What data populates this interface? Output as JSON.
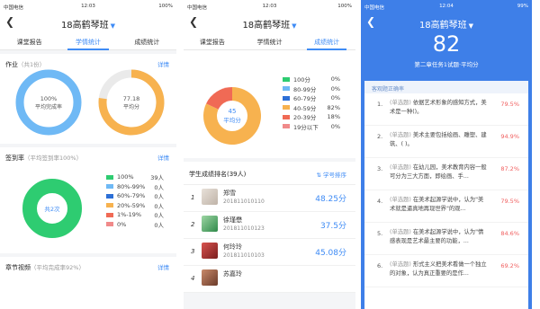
{
  "status": {
    "carrier": "中国电信",
    "p1": {
      "time": "12:03",
      "battery": "100%"
    },
    "p2": {
      "time": "12:03",
      "battery": "100%"
    },
    "p3": {
      "time": "12:04",
      "battery": "99%"
    }
  },
  "header_title": "18高鹤琴班",
  "tabs": [
    "课堂报告",
    "学情统计",
    "成绩统计"
  ],
  "colors": {
    "accent": "#3e8bf5",
    "green": "#2ecc71",
    "blue_light": "#6fb9f5",
    "orange": "#f7b24f",
    "red": "#f06a55",
    "gray": "#e0e0e0"
  },
  "p1": {
    "homework": {
      "title": "作业",
      "sub": "（共1份）",
      "detail": "详情",
      "left_ring": {
        "value": "100%",
        "label": "平均完成率",
        "fraction": 1.0
      },
      "right_ring": {
        "value": "77.18",
        "label": "平均分",
        "fraction": 0.7718
      }
    },
    "signin": {
      "title": "签到率",
      "sub": "（平均签到率100%）",
      "detail": "详情",
      "center": "共2次",
      "legend": [
        {
          "label": "100%",
          "count": "39人",
          "color": "#2ecc71"
        },
        {
          "label": "80%-99%",
          "count": "0人",
          "color": "#6fb9f5"
        },
        {
          "label": "60%-79%",
          "count": "0人",
          "color": "#2c6fd6"
        },
        {
          "label": "20%-59%",
          "count": "0人",
          "color": "#f7b24f"
        },
        {
          "label": "1%-19%",
          "count": "0人",
          "color": "#f06a55"
        },
        {
          "label": "0%",
          "count": "0人",
          "color": "#f08a8a"
        }
      ]
    },
    "video": {
      "title": "章节视频",
      "sub": "（平均完成率92%）",
      "detail": "详情"
    }
  },
  "p2": {
    "donut_center_value": "45",
    "donut_center_label": "平均分",
    "ranking_title": "学生成绩排名(39人)",
    "sort_label": "学号排序",
    "rows": [
      {
        "rank": "1",
        "name": "郑雪",
        "id": "201811010110",
        "score": "48.25分"
      },
      {
        "rank": "2",
        "name": "徐瑾懋",
        "id": "201811010123",
        "score": "37.5分"
      },
      {
        "rank": "3",
        "name": "何玲玲",
        "id": "201811010103",
        "score": "45.08分"
      },
      {
        "rank": "4",
        "name": "苏嘉玲",
        "id": "",
        "score": ""
      }
    ]
  },
  "chart_data": {
    "type": "pie",
    "categories": [
      "100分",
      "80-99分",
      "60-79分",
      "40-59分",
      "20-39分",
      "19分以下"
    ],
    "values": [
      0,
      0,
      0,
      82,
      18,
      0
    ],
    "value_labels": [
      "0%",
      "0%",
      "0%",
      "82%",
      "18%",
      "0%"
    ],
    "colors": [
      "#2ecc71",
      "#6fb9f5",
      "#2c6fd6",
      "#f7b24f",
      "#f06a55",
      "#f08a8a"
    ]
  },
  "p3": {
    "big_score": "82",
    "subtitle": "第二章任务1试题·平均分",
    "list_title": "客观题正确率",
    "questions": [
      {
        "num": "1.",
        "tag": "(单选题)",
        "text": "依据艺术形象的感知方式，美术是一种()。",
        "pct": "79.5%"
      },
      {
        "num": "2.",
        "tag": "(单选题)",
        "text": "美术主要包括绘画、雕塑、建筑、( )。",
        "pct": "94.9%"
      },
      {
        "num": "3.",
        "tag": "(单选题)",
        "text": "在幼儿园，美术教育内容一般可分为三大方面，即绘画、手...",
        "pct": "87.2%"
      },
      {
        "num": "4.",
        "tag": "(单选题)",
        "text": "在美术起源学说中，认为\"美术就是逼真地再现世界\"的观...",
        "pct": "79.5%"
      },
      {
        "num": "5.",
        "tag": "(单选题)",
        "text": "在美术起源学说中，认为\"情感表现是艺术最主要的功能，...",
        "pct": "84.6%"
      },
      {
        "num": "6.",
        "tag": "(单选题)",
        "text": "形式主义把美术看做一个独立的对象，认为真正重要的是作...",
        "pct": "69.2%"
      }
    ]
  }
}
